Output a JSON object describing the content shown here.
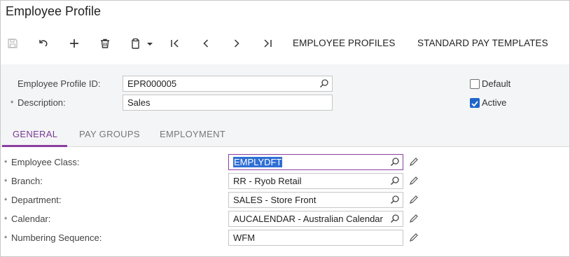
{
  "window": {
    "title": "Employee Profile"
  },
  "toolbar": {
    "icons": [
      "save-icon",
      "undo-icon",
      "add-icon",
      "delete-icon",
      "copy-paste-icon",
      "first-record-icon",
      "previous-record-icon",
      "next-record-icon",
      "last-record-icon"
    ],
    "employee_profiles_label": "EMPLOYEE PROFILES",
    "standard_pay_templates_label": "STANDARD PAY TEMPLATES"
  },
  "header": {
    "profile_id_label": "Employee Profile ID:",
    "profile_id_value": "EPR000005",
    "description_label": "Description:",
    "description_value": "Sales",
    "required_mark": "*",
    "default_label": "Default",
    "default_checked": false,
    "active_label": "Active",
    "active_checked": true
  },
  "tabs": [
    {
      "label": "GENERAL",
      "active": true
    },
    {
      "label": "PAY GROUPS",
      "active": false
    },
    {
      "label": "EMPLOYMENT",
      "active": false
    }
  ],
  "general": {
    "employee_class_label": "Employee Class:",
    "employee_class_value": "EMPLYDFT",
    "branch_label": "Branch:",
    "branch_value": "RR - Ryob Retail",
    "department_label": "Department:",
    "department_value": "SALES - Store Front",
    "calendar_label": "Calendar:",
    "calendar_value": "AUCALENDAR - Australian Calendar",
    "numbering_label": "Numbering Sequence:",
    "numbering_value": "WFM"
  },
  "colors": {
    "accent": "#8a3fa0",
    "checkbox": "#1f66c9",
    "panel": "#f4f5f6"
  }
}
